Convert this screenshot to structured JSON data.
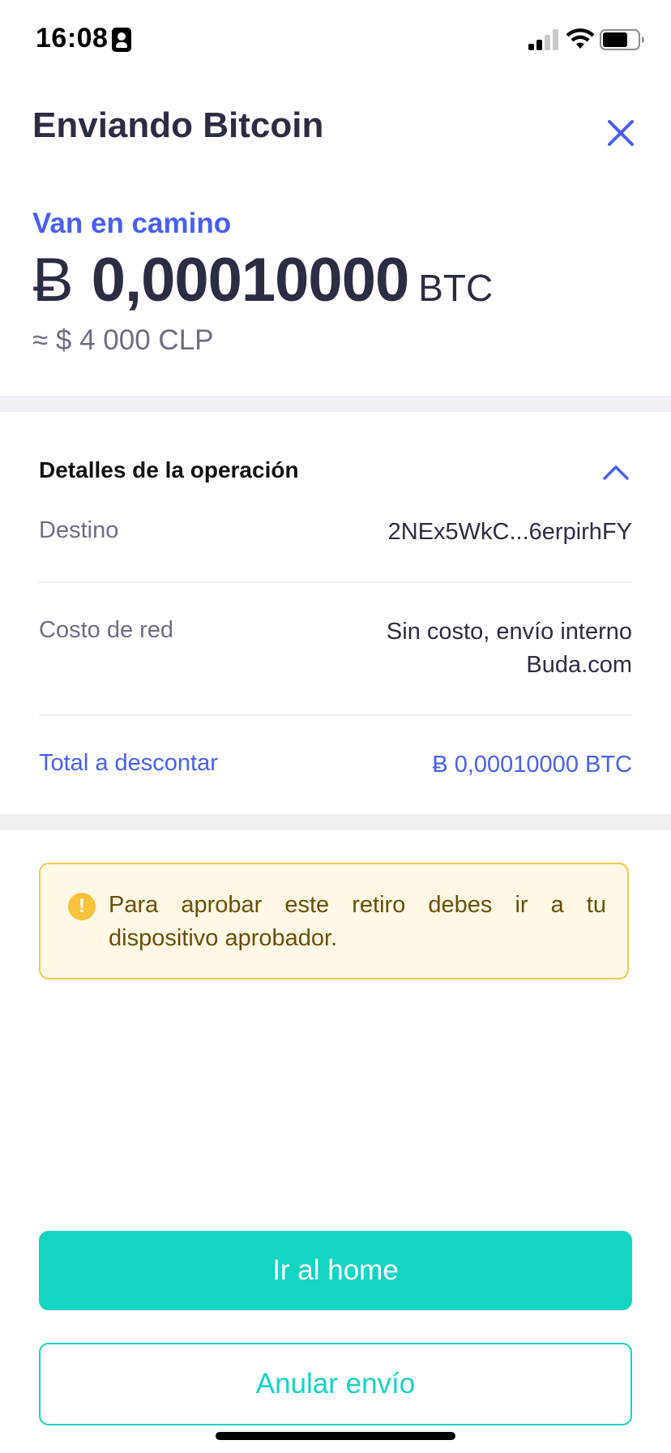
{
  "status_bar": {
    "time": "16:08"
  },
  "header": {
    "title": "Enviando Bitcoin",
    "close_icon": "close-icon"
  },
  "amount": {
    "status_label": "Van en camino",
    "currency_symbol": "Ƀ",
    "value": "0,00010000",
    "unit": "BTC",
    "fiat_equivalent": "≈ $ 4 000 CLP"
  },
  "details": {
    "title": "Detalles de la operación",
    "rows": [
      {
        "label": "Destino",
        "value": "2NEx5WkC...6erpirhFY"
      },
      {
        "label": "Costo de red",
        "value_line1": "Sin costo, envío interno",
        "value_line2": "Buda.com"
      },
      {
        "label": "Total a descontar",
        "value": "Ƀ 0,00010000 BTC"
      }
    ]
  },
  "warning": {
    "icon": "alert-icon",
    "text": "Para aprobar este retiro debes ir a tu dispositivo aprobador."
  },
  "actions": {
    "primary_label": "Ir al home",
    "secondary_label": "Anular envío"
  },
  "colors": {
    "accent": "#4a5ef0",
    "teal": "#14d4c3",
    "warning_border": "#f1c84b",
    "warning_bg": "#fff8e6"
  }
}
